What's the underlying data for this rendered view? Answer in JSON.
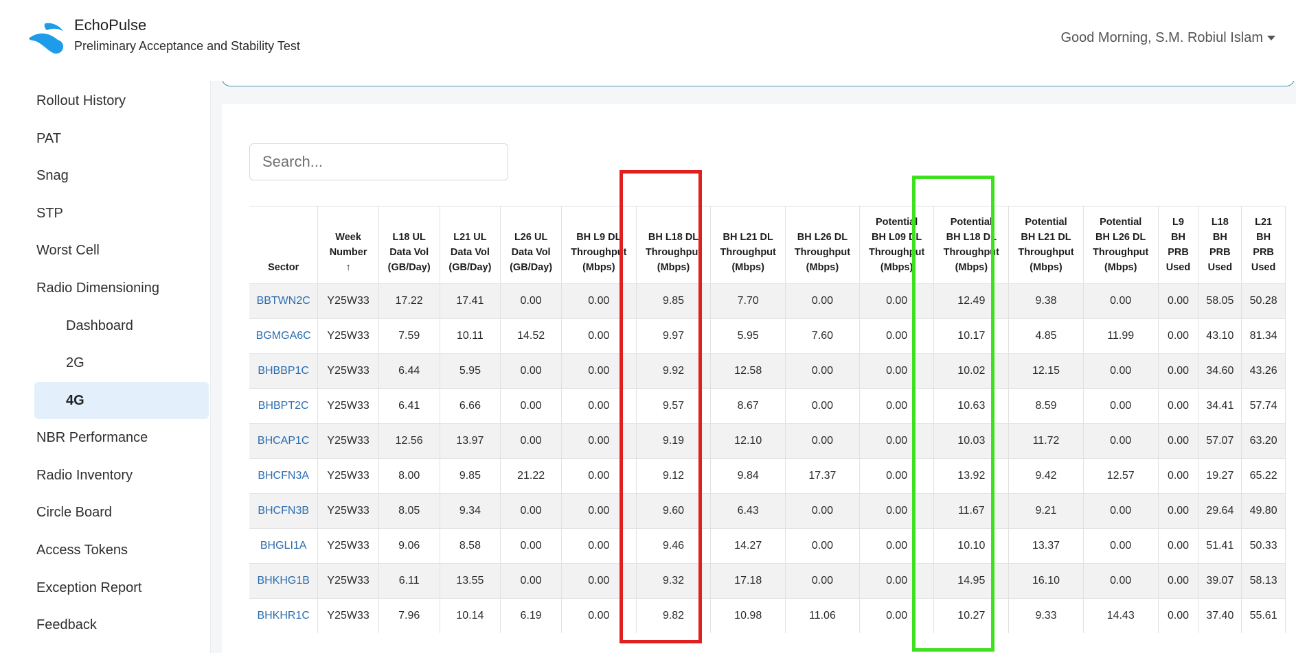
{
  "header": {
    "app_name": "EchoPulse",
    "app_subtitle": "Preliminary Acceptance and Stability Test",
    "greeting": "Good Morning, S.M. Robiul Islam"
  },
  "sidebar": {
    "items": [
      {
        "label": "Rollout History",
        "icon": "cloud-upload-icon",
        "has_chevron": true
      },
      {
        "label": "PAT",
        "icon": "list-icon",
        "has_chevron": true
      },
      {
        "label": "Snag",
        "icon": "card-list-icon",
        "has_chevron": true
      },
      {
        "label": "STP",
        "icon": "grid-icon",
        "has_chevron": true
      },
      {
        "label": "Worst Cell",
        "icon": "grid-icon",
        "has_chevron": true
      },
      {
        "label": "Radio Dimensioning",
        "icon": "antenna-icon",
        "has_chevron": true
      },
      {
        "label": "Dashboard",
        "icon": "speedometer-icon",
        "sub": true
      },
      {
        "label": "2G",
        "icon": "graph-up-icon",
        "sub": true
      },
      {
        "label": "4G",
        "icon": "graph-up-icon",
        "sub": true,
        "active": true
      },
      {
        "label": "NBR Performance",
        "icon": "diagram-icon",
        "has_chevron": false
      },
      {
        "label": "Radio Inventory",
        "icon": "boxes-icon",
        "has_chevron": true
      },
      {
        "label": "Circle Board",
        "icon": "bounding-box-icon",
        "has_chevron": false
      },
      {
        "label": "Access Tokens",
        "icon": "key-icon",
        "has_chevron": false
      },
      {
        "label": "Exception Report",
        "icon": "exclamation-circle-icon",
        "has_chevron": false
      },
      {
        "label": "Feedback",
        "icon": "list-icon",
        "has_chevron": true
      }
    ]
  },
  "search": {
    "placeholder": "Search...",
    "value": ""
  },
  "table": {
    "columns": [
      [
        "Sector"
      ],
      [
        "Week",
        "Number",
        "↑"
      ],
      [
        "L18 UL",
        "Data Vol",
        "(GB/Day)"
      ],
      [
        "L21 UL",
        "Data Vol",
        "(GB/Day)"
      ],
      [
        "L26 UL",
        "Data Vol",
        "(GB/Day)"
      ],
      [
        "BH L9 DL",
        "Throughput",
        "(Mbps)"
      ],
      [
        "BH L18 DL",
        "Throughput",
        "(Mbps)"
      ],
      [
        "BH L21 DL",
        "Throughput",
        "(Mbps)"
      ],
      [
        "BH L26 DL",
        "Throughput",
        "(Mbps)"
      ],
      [
        "Potential",
        "BH L09 DL",
        "Throughput",
        "(Mbps)"
      ],
      [
        "Potential",
        "BH L18 DL",
        "Throughput",
        "(Mbps)"
      ],
      [
        "Potential",
        "BH L21 DL",
        "Throughput",
        "(Mbps)"
      ],
      [
        "Potential",
        "BH L26 DL",
        "Throughput",
        "(Mbps)"
      ],
      [
        "L9",
        "BH",
        "PRB",
        "Used"
      ],
      [
        "L18",
        "BH",
        "PRB",
        "Used"
      ],
      [
        "L21",
        "BH",
        "PRB",
        "Used"
      ]
    ],
    "rows": [
      [
        "BBTWN2C",
        "Y25W33",
        "17.22",
        "17.41",
        "0.00",
        "0.00",
        "9.85",
        "7.70",
        "0.00",
        "0.00",
        "12.49",
        "9.38",
        "0.00",
        "0.00",
        "58.05",
        "50.28"
      ],
      [
        "BGMGA6C",
        "Y25W33",
        "7.59",
        "10.11",
        "14.52",
        "0.00",
        "9.97",
        "5.95",
        "7.60",
        "0.00",
        "10.17",
        "4.85",
        "11.99",
        "0.00",
        "43.10",
        "81.34"
      ],
      [
        "BHBBP1C",
        "Y25W33",
        "6.44",
        "5.95",
        "0.00",
        "0.00",
        "9.92",
        "12.58",
        "0.00",
        "0.00",
        "10.02",
        "12.15",
        "0.00",
        "0.00",
        "34.60",
        "43.26"
      ],
      [
        "BHBPT2C",
        "Y25W33",
        "6.41",
        "6.66",
        "0.00",
        "0.00",
        "9.57",
        "8.67",
        "0.00",
        "0.00",
        "10.63",
        "8.59",
        "0.00",
        "0.00",
        "34.41",
        "57.74"
      ],
      [
        "BHCAP1C",
        "Y25W33",
        "12.56",
        "13.97",
        "0.00",
        "0.00",
        "9.19",
        "12.10",
        "0.00",
        "0.00",
        "10.03",
        "11.72",
        "0.00",
        "0.00",
        "57.07",
        "63.20"
      ],
      [
        "BHCFN3A",
        "Y25W33",
        "8.00",
        "9.85",
        "21.22",
        "0.00",
        "9.12",
        "9.84",
        "17.37",
        "0.00",
        "13.92",
        "9.42",
        "12.57",
        "0.00",
        "19.27",
        "65.22"
      ],
      [
        "BHCFN3B",
        "Y25W33",
        "8.05",
        "9.34",
        "0.00",
        "0.00",
        "9.60",
        "6.43",
        "0.00",
        "0.00",
        "11.67",
        "9.21",
        "0.00",
        "0.00",
        "29.64",
        "49.80"
      ],
      [
        "BHGLI1A",
        "Y25W33",
        "9.06",
        "8.58",
        "0.00",
        "0.00",
        "9.46",
        "14.27",
        "0.00",
        "0.00",
        "10.10",
        "13.37",
        "0.00",
        "0.00",
        "51.41",
        "50.33"
      ],
      [
        "BHKHG1B",
        "Y25W33",
        "6.11",
        "13.55",
        "0.00",
        "0.00",
        "9.32",
        "17.18",
        "0.00",
        "0.00",
        "14.95",
        "16.10",
        "0.00",
        "0.00",
        "39.07",
        "58.13"
      ],
      [
        "BHKHR1C",
        "Y25W33",
        "7.96",
        "10.14",
        "6.19",
        "0.00",
        "9.82",
        "10.98",
        "11.06",
        "0.00",
        "10.27",
        "9.33",
        "14.43",
        "0.00",
        "37.40",
        "55.61"
      ]
    ]
  },
  "colors": {
    "accent": "#1e9be9",
    "link": "#2b6cb0",
    "active_bg": "#e3f0fb",
    "highlight_red": "#e21f1f",
    "highlight_green": "#3fe01d"
  }
}
